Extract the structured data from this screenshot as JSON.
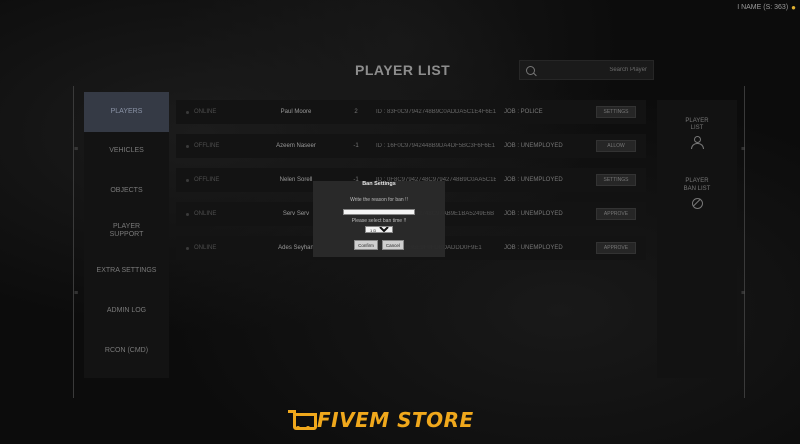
{
  "header": {
    "user_text": "I NAME (S: 363)",
    "coin_icon": "coin-icon",
    "title": "PLAYER LIST",
    "search_placeholder": "Search Player"
  },
  "sidebar": {
    "items": [
      {
        "label": "PLAYERS",
        "active": true
      },
      {
        "label": "VEHICLES"
      },
      {
        "label": "OBJECTS"
      },
      {
        "label": "PLAYER SUPPORT"
      },
      {
        "label": "EXTRA SETTINGS"
      },
      {
        "label": "ADMIN LOG"
      },
      {
        "label": "RCON (CMD)"
      }
    ]
  },
  "players": [
    {
      "status": "ONLINE",
      "name": "Paul Moore",
      "id": "2",
      "identifier": "ID : 83F0C97942748B9C0ADDA5C1E4F6E1",
      "job": "JOB : POLICE",
      "action": "SETTINGS"
    },
    {
      "status": "OFFLINE",
      "name": "Azeem Naseer",
      "id": "-1",
      "identifier": "ID : 16F0C97942448B9DA4DF5BC3F6F6E1",
      "job": "JOB : UNEMPLOYED",
      "action": "ALLOW"
    },
    {
      "status": "OFFLINE",
      "name": "Nelen Sorell",
      "id": "-1",
      "identifier": "ID : 0F8C97942748C97942748B9C0AA5C1E4",
      "job": "JOB : UNEMPLOYED",
      "action": "SETTINGS"
    },
    {
      "status": "ONLINE",
      "name": "Serv Serv",
      "id": "3",
      "identifier": "ID : 83F0C97942748C97AB9E1BA5249E6B",
      "job": "JOB : UNEMPLOYED",
      "action": "APPROVE"
    },
    {
      "status": "ONLINE",
      "name": "Ades Seyhan",
      "id": "4",
      "identifier": "ID : 7A8BE9B5E9F0FDBDADDD0F9E1",
      "job": "JOB : UNEMPLOYED",
      "action": "APPROVE"
    }
  ],
  "right_panel": {
    "player_list_label": "PLAYER LIST",
    "player_list_icon": "person-icon",
    "ban_list_label": "PLAYER BAN LIST",
    "ban_list_icon": "ban-icon"
  },
  "ban_modal": {
    "title": "Ban Settings",
    "reason_label": "Write the reason for ban !!",
    "reason_value": "",
    "time_label": "Please select ban time !!",
    "time_selected": "1 Day",
    "confirm_label": "Confirm",
    "cancel_label": "Cancel"
  },
  "footer": {
    "logo_text": "FIVEM STORE",
    "logo_icon": "cart-icon",
    "brand_color": "#f0a81c"
  }
}
